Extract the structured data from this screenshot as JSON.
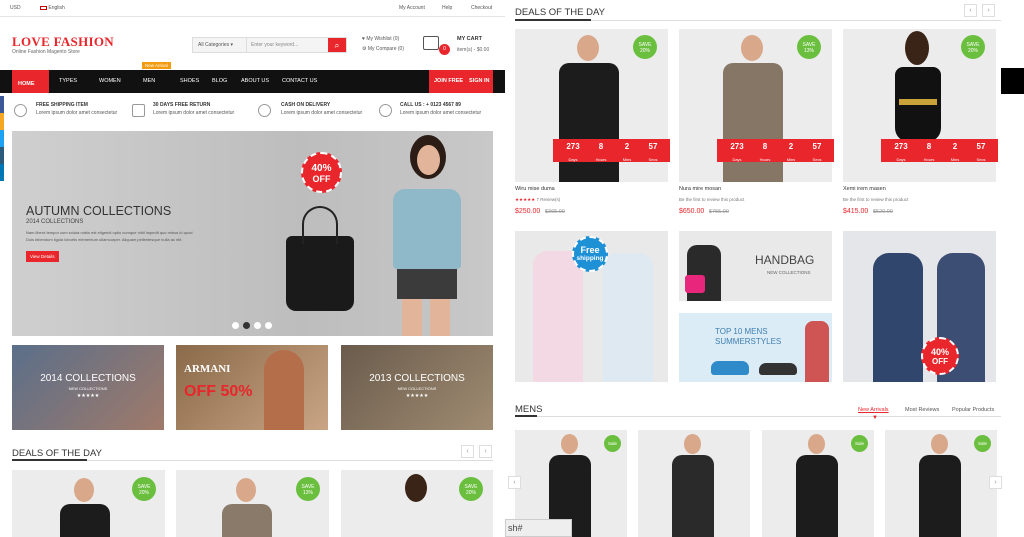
{
  "topbar": {
    "currency": "USD",
    "language": "English",
    "links": [
      "My Account",
      "Help",
      "Checkout"
    ]
  },
  "logo": {
    "title": "LOVE FASHION",
    "tagline": "Online Fashion Magento Store"
  },
  "search": {
    "category": "All Categories",
    "placeholder": "Enter your keyword..."
  },
  "header_links": {
    "wishlist": "My Wishlist (0)",
    "compare": "My Compare (0)"
  },
  "cart": {
    "label": "MY CART",
    "count": "0",
    "summary": "item(s) - $0.00"
  },
  "nav": {
    "new_badge": "New Arrival",
    "items": [
      "HOME",
      "TYPES",
      "WOMEN",
      "MEN",
      "SHOES",
      "BLOG",
      "ABOUT US",
      "CONTACT US"
    ],
    "join": "JOIN FREE",
    "signin": "SIGN IN"
  },
  "features": [
    {
      "title": "FREE SHIPPING ITEM",
      "desc": "Lorem ipsum dolor amet consectetur"
    },
    {
      "title": "30 DAYS FREE RETURN",
      "desc": "Lorem ipsum dolor amet consectetur"
    },
    {
      "title": "CASH ON DELIVERY",
      "desc": "Lorem ipsum dolor amet consectetur"
    },
    {
      "title": "CALL US : + 0123 4567 89",
      "desc": "Lorem ipsum dolor amet consectetur"
    }
  ],
  "hero": {
    "title": "AUTUMN COLLECTIONS",
    "subtitle": "2014 COLLECTIONS",
    "text1": "Nam liberd tempor cum soluta nobis est eligendi optio cumque nihil impedit quo minus id quod",
    "text2": "Duis bibendum ligula lobortis elementum ullamcorper. Aliquam pellentesque nulla ac elit.",
    "button": "View Details",
    "badge_pct": "40%",
    "badge_off": "OFF"
  },
  "banners": [
    {
      "title": "2014 COLLECTIONS",
      "sub": "NEW COLLECTIONS",
      "stars": "★★★★★"
    },
    {
      "title": "ARMANI",
      "sub": "OFF 50%",
      "stars": ""
    },
    {
      "title": "2013 COLLECTIONS",
      "sub": "NEW COLLECTIONS",
      "stars": "★★★★★"
    }
  ],
  "deals": {
    "title": "DEALS OF THE DAY",
    "prev": "‹",
    "next": "›"
  },
  "deal_products": [
    {
      "save": "SAVE",
      "pct": "20%",
      "name": "Wiru mise duma",
      "review": "7 Review(s)",
      "price": "$250.00",
      "old": "$365.00"
    },
    {
      "save": "SAVE",
      "pct": "13%",
      "name": "Nura mire mosan",
      "review": "Be the first to review this product",
      "price": "$650.00",
      "old": "$755.00"
    },
    {
      "save": "SAVE",
      "pct": "20%",
      "name": "Xemi irem masen",
      "review": "Be the first to review this product",
      "price": "$415.00",
      "old": "$520.00"
    }
  ],
  "timer": {
    "values": [
      "273",
      "8",
      "2",
      "57"
    ],
    "labels": [
      "Days",
      "Hours",
      "Mins",
      "Secs"
    ]
  },
  "promos": {
    "free": "Free",
    "shipping": "shipping",
    "handbag": "HANDBAG",
    "handbag_sub": "NEW COLLECTIONS",
    "top10": "TOP 10 MENS",
    "summer": "SUMMERSTYLES",
    "pct": "40%",
    "off": "OFF"
  },
  "mens": {
    "title": "MENS",
    "tabs": [
      "New Arrivals",
      "Most Reviews",
      "Popular Products"
    ],
    "sale": "Sale"
  },
  "statusbar": "sh#",
  "colors": {
    "accent": "#e8262b",
    "save": "#6bbf3f",
    "nav": "#111111"
  }
}
